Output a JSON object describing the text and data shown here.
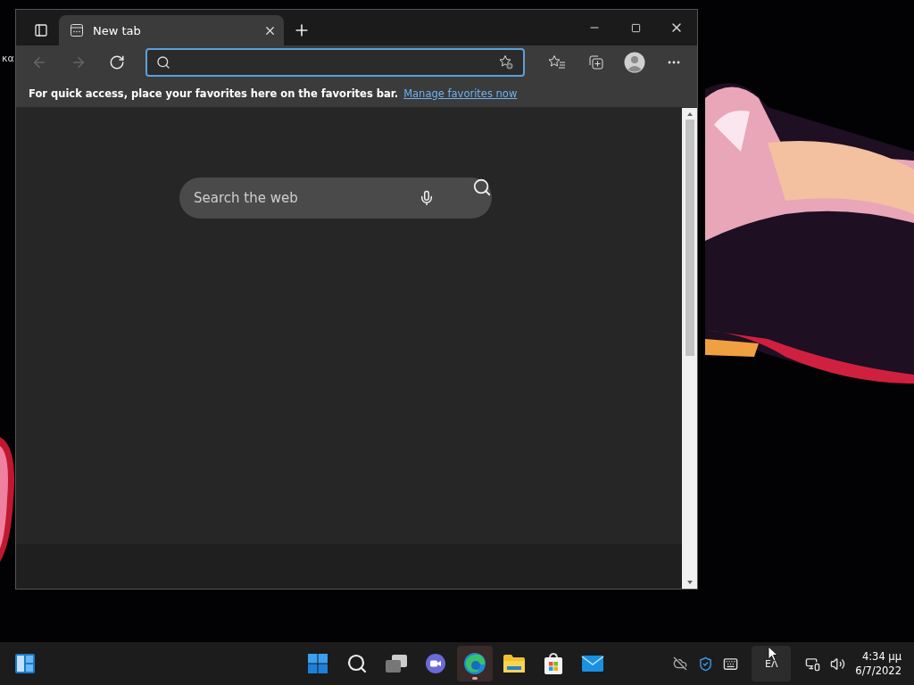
{
  "desktop": {
    "text_fragment": "κα"
  },
  "browser": {
    "tabs": [
      {
        "title": "New tab",
        "selected": true
      }
    ],
    "toolbar": {
      "back_disabled": true,
      "forward_disabled": true,
      "address_focused": true
    },
    "favorites_bar": {
      "message": "For quick access, place your favorites here on the favorites bar.",
      "link": "Manage favorites now"
    },
    "search_box": {
      "placeholder": "Search the web"
    }
  },
  "taskbar": {
    "apps": [
      {
        "kind": "start",
        "selected": false
      },
      {
        "kind": "search",
        "selected": false
      },
      {
        "kind": "taskview",
        "selected": false
      },
      {
        "kind": "chat",
        "selected": false
      },
      {
        "kind": "edge",
        "selected": true
      },
      {
        "kind": "explorer",
        "selected": false
      },
      {
        "kind": "store",
        "selected": false
      },
      {
        "kind": "mail",
        "selected": false
      }
    ],
    "tray": {
      "language": "ΕΛ",
      "language_hovered": true,
      "time": "4:34 μμ",
      "date": "6/7/2022"
    }
  }
}
